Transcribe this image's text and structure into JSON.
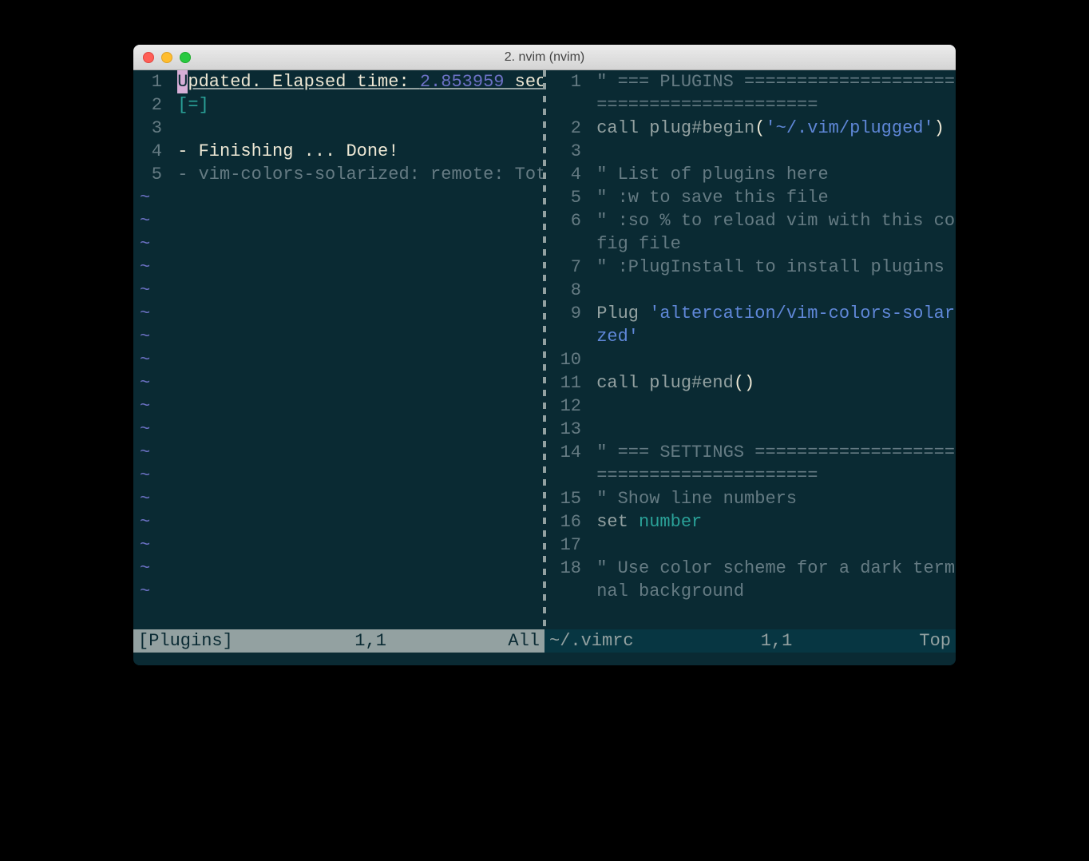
{
  "window": {
    "title": "2. nvim (nvim)"
  },
  "left_pane": {
    "lines": [
      {
        "n": "1",
        "parts": [
          {
            "cls": "cursor",
            "t": "U"
          },
          {
            "cls": "underline white",
            "t": "pdated. Elapsed time: "
          },
          {
            "cls": "underline violet",
            "t": "2.853959"
          },
          {
            "cls": "underline white",
            "t": " sec."
          }
        ]
      },
      {
        "n": "2",
        "parts": [
          {
            "cls": "cyan",
            "t": "[=]"
          }
        ]
      },
      {
        "n": "3",
        "parts": []
      },
      {
        "n": "4",
        "parts": [
          {
            "cls": "white",
            "t": "- Finishing ... Done!"
          }
        ]
      },
      {
        "n": "5",
        "parts": [
          {
            "cls": "grey",
            "t": "- vim-colors-solarized: remote: Tota"
          }
        ]
      }
    ],
    "tilde_count": 18
  },
  "right_pane": {
    "lines": [
      {
        "n": "1",
        "wrap": false,
        "parts": [
          {
            "cls": "grey",
            "t": "\" === PLUGINS ======================="
          }
        ]
      },
      {
        "n": "",
        "wrap": true,
        "parts": [
          {
            "cls": "grey",
            "t": "====================="
          }
        ]
      },
      {
        "n": "2",
        "wrap": false,
        "parts": [
          {
            "cls": "txt",
            "t": "call plug#begin"
          },
          {
            "cls": "white",
            "t": "("
          },
          {
            "cls": "blue",
            "t": "'~/.vim/plugged'"
          },
          {
            "cls": "white",
            "t": ")"
          }
        ]
      },
      {
        "n": "3",
        "wrap": false,
        "parts": []
      },
      {
        "n": "4",
        "wrap": false,
        "parts": [
          {
            "cls": "grey",
            "t": "\" List of plugins here"
          }
        ]
      },
      {
        "n": "5",
        "wrap": false,
        "parts": [
          {
            "cls": "grey",
            "t": "\" :w to save this file"
          }
        ]
      },
      {
        "n": "6",
        "wrap": false,
        "parts": [
          {
            "cls": "grey",
            "t": "\" :so % to reload vim with this con"
          }
        ]
      },
      {
        "n": "",
        "wrap": true,
        "parts": [
          {
            "cls": "grey",
            "t": "fig file"
          }
        ]
      },
      {
        "n": "7",
        "wrap": false,
        "parts": [
          {
            "cls": "grey",
            "t": "\" :PlugInstall to install plugins"
          }
        ]
      },
      {
        "n": "8",
        "wrap": false,
        "parts": []
      },
      {
        "n": "9",
        "wrap": false,
        "parts": [
          {
            "cls": "txt",
            "t": "Plug "
          },
          {
            "cls": "blue",
            "t": "'altercation/vim-colors-solari"
          }
        ]
      },
      {
        "n": "",
        "wrap": true,
        "parts": [
          {
            "cls": "blue",
            "t": "zed'"
          }
        ]
      },
      {
        "n": "10",
        "wrap": false,
        "parts": []
      },
      {
        "n": "11",
        "wrap": false,
        "parts": [
          {
            "cls": "txt",
            "t": "call plug#end"
          },
          {
            "cls": "white",
            "t": "()"
          }
        ]
      },
      {
        "n": "12",
        "wrap": false,
        "parts": []
      },
      {
        "n": "13",
        "wrap": false,
        "parts": []
      },
      {
        "n": "14",
        "wrap": false,
        "parts": [
          {
            "cls": "grey",
            "t": "\" === SETTINGS ======================"
          }
        ]
      },
      {
        "n": "",
        "wrap": true,
        "parts": [
          {
            "cls": "grey",
            "t": "====================="
          }
        ]
      },
      {
        "n": "15",
        "wrap": false,
        "parts": [
          {
            "cls": "grey",
            "t": "\" Show line numbers"
          }
        ]
      },
      {
        "n": "16",
        "wrap": false,
        "parts": [
          {
            "cls": "txt",
            "t": "set "
          },
          {
            "cls": "cyan",
            "t": "number"
          }
        ]
      },
      {
        "n": "17",
        "wrap": false,
        "parts": []
      },
      {
        "n": "18",
        "wrap": false,
        "parts": [
          {
            "cls": "grey",
            "t": "\" Use color scheme for a dark termi"
          }
        ]
      },
      {
        "n": "",
        "wrap": true,
        "parts": [
          {
            "cls": "grey",
            "t": "nal background"
          }
        ]
      }
    ]
  },
  "status": {
    "left": {
      "name": "[Plugins]",
      "pos": "1,1",
      "scroll": "All"
    },
    "right": {
      "name": "~/.vimrc",
      "pos": "1,1",
      "scroll": "Top"
    }
  }
}
